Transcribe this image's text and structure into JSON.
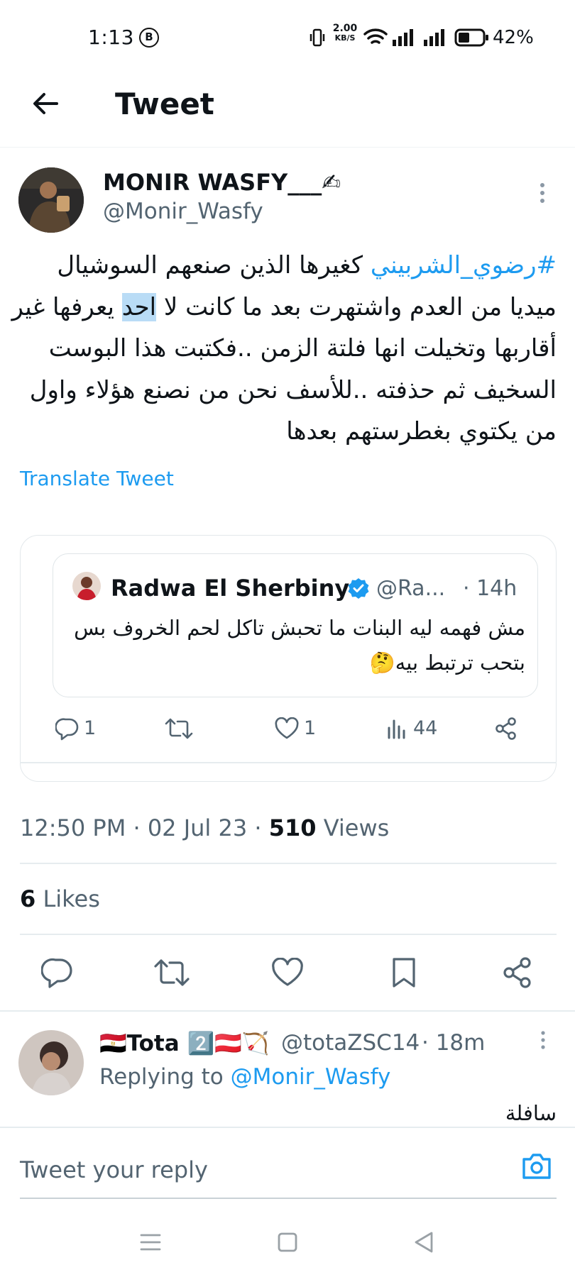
{
  "status": {
    "time": "1:13",
    "b_icon": "B",
    "net_speed_value": "2.00",
    "net_speed_unit": "KB/S",
    "battery_pct": "42%",
    "icons": [
      "vibrate-icon",
      "wifi-icon",
      "signal-icon",
      "signal-icon",
      "battery-icon"
    ]
  },
  "header": {
    "title": "Tweet"
  },
  "tweet": {
    "author_name": "MONIR WASFY___✍",
    "author_handle": "@Monir_Wasfy",
    "hashtag": "#رضوي_الشربيني",
    "body_1": " كغيرها الذين صنعهم السوشيال ميديا من العدم واشتهرت بعد ما كانت لا ",
    "body_hl": "احد",
    "body_2": " يعرفها غير أقاربها وتخيلت انها فلتة الزمن ..فكتبت هذا البوست السخيف ثم حذفته ..للأسف نحن من نصنع هؤلاء واول من يكتوي بغطرستهم بعدها",
    "translate": "Translate Tweet",
    "quote": {
      "name": "Radwa El Sherbiny",
      "handle": "@Ra...",
      "time": "· 14h",
      "text": "مش فهمه ليه البنات ما تحبش تاكل لحم الخروف بس بتحب ترتبط بيه🤔",
      "replies": "1",
      "likes": "1",
      "views": "44"
    },
    "time": "12:50 PM",
    "date": "02 Jul 23",
    "views_count": "510",
    "views_label": "Views",
    "likes_count": "6",
    "likes_label": "Likes"
  },
  "reply": {
    "name": "🇪🇬Tota 2️⃣🇦🇹🏹",
    "handle": "@totaZSC14",
    "time": "· 18m",
    "replying_to_label": "Replying to",
    "replying_to": "@Monir_Wasfy",
    "text": "سافلة"
  },
  "compose": {
    "placeholder": "Tweet your reply"
  },
  "colors": {
    "accent": "#1d9bf0",
    "text": "#0f1419",
    "muted": "#536471"
  }
}
